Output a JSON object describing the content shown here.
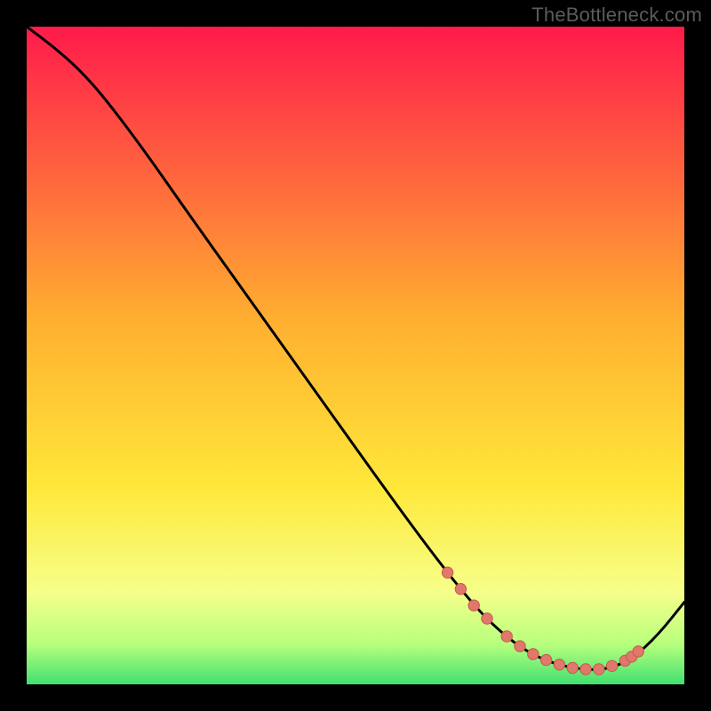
{
  "watermark": "TheBottleneck.com",
  "colors": {
    "bg": "#000000",
    "curve": "#000000",
    "marker_fill": "#e0786b",
    "marker_stroke": "#c9584c",
    "gradient_top": "#ff1a4b",
    "gradient_mid": "#ffd23a",
    "gradient_low": "#f6ff8a",
    "gradient_green1": "#b6ff7d",
    "gradient_green2": "#40e070"
  },
  "chart_data": {
    "type": "line",
    "title": "",
    "xlabel": "",
    "ylabel": "",
    "xlim": [
      0,
      100
    ],
    "ylim": [
      0,
      100
    ],
    "series": [
      {
        "name": "curve",
        "x": [
          0,
          4,
          8,
          12,
          18,
          25,
          35,
          45,
          55,
          62,
          68,
          72,
          76,
          80,
          84,
          88,
          92,
          96,
          100
        ],
        "y": [
          100,
          97,
          93.5,
          89,
          81,
          71,
          57,
          43,
          29,
          19.5,
          12,
          8,
          5,
          3.2,
          2.3,
          2.2,
          3.8,
          7.5,
          12.5
        ]
      }
    ],
    "markers": {
      "name": "highlight-points",
      "x": [
        64,
        66,
        68,
        70,
        73,
        75,
        77,
        79,
        81,
        83,
        85,
        87,
        89,
        91,
        92,
        93
      ],
      "y": [
        17,
        14.5,
        12,
        10,
        7.3,
        5.8,
        4.6,
        3.7,
        3.0,
        2.5,
        2.3,
        2.3,
        2.8,
        3.6,
        4.2,
        5.0
      ]
    }
  }
}
